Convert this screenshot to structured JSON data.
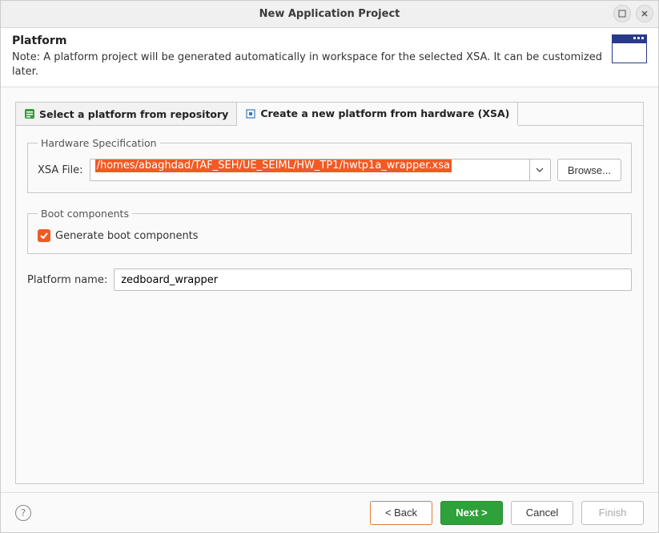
{
  "window": {
    "title": "New Application Project"
  },
  "header": {
    "title": "Platform",
    "note": "Note: A platform project will be generated automatically in workspace for the selected XSA. It can be customized later."
  },
  "tabs": {
    "repo": "Select a platform from repository",
    "create": "Create a new platform from hardware (XSA)"
  },
  "hw_spec": {
    "legend": "Hardware Specification",
    "xsa_label": "XSA File:",
    "xsa_value": "/homes/abaghdad/TAF_SEH/UE_SEIML/HW_TP1/hwtp1a_wrapper.xsa",
    "browse": "Browse..."
  },
  "boot": {
    "legend": "Boot components",
    "generate_label": "Generate boot components",
    "generate_checked": true
  },
  "platform": {
    "name_label": "Platform name:",
    "name_value": "zedboard_wrapper"
  },
  "footer": {
    "back": "< Back",
    "next": "Next >",
    "cancel": "Cancel",
    "finish": "Finish"
  }
}
